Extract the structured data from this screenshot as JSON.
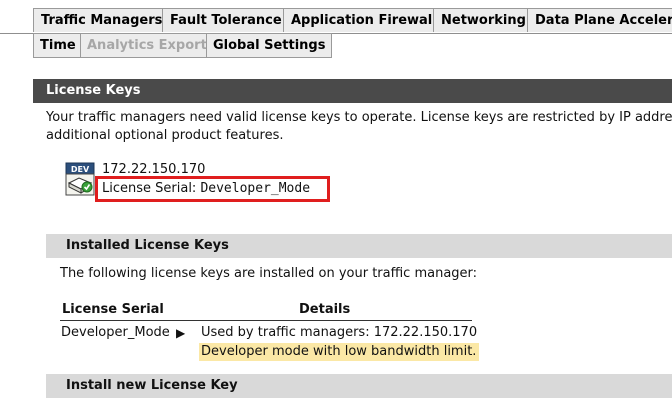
{
  "top_tabs": [
    "Traffic Managers",
    "Fault Tolerance",
    "Application Firewall",
    "Networking",
    "Data Plane Accelera"
  ],
  "sub_tabs": [
    {
      "label": "Time",
      "enabled": true
    },
    {
      "label": "Analytics Export",
      "enabled": false
    },
    {
      "label": "Global Settings",
      "enabled": true
    }
  ],
  "license_section": {
    "title": "License Keys",
    "description_line1": "Your traffic managers need valid license keys to operate. License keys are restricted by IP address or",
    "description_line2": "additional optional product features.",
    "icon_label": "DEV",
    "ip_address": "172.22.150.170",
    "serial_label": "License Serial:",
    "serial_value": "Developer_Mode"
  },
  "installed": {
    "title": "Installed License Keys",
    "description": "The following license keys are installed on your traffic manager:",
    "columns": [
      "License Serial",
      "Details"
    ],
    "rows": [
      {
        "serial": "Developer_Mode",
        "usage": "Used by traffic managers: 172.22.150.170",
        "note": "Developer mode with low bandwidth limit."
      }
    ]
  },
  "install_new": {
    "title": "Install new License Key"
  },
  "colors": {
    "section_bar": "#4a4a4a",
    "subhead_bar": "#d9d9d9",
    "highlight_box": "#e01e1e",
    "note_bg": "#fbe8a6",
    "tab_bg": "#ececec",
    "disabled_text": "#a7a7a7"
  }
}
